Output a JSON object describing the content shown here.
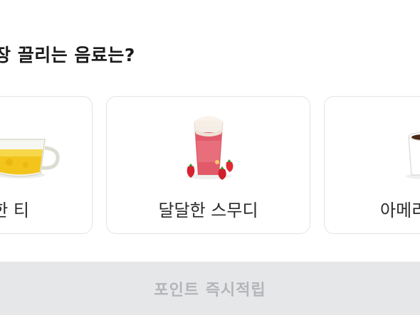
{
  "question": "장 끌리는 음료는?",
  "options": [
    {
      "label": "한 티",
      "icon": "tea-cup-icon"
    },
    {
      "label": "달달한 스무디",
      "icon": "strawberry-smoothie-icon"
    },
    {
      "label": "아메리",
      "icon": "coffee-cup-icon"
    }
  ],
  "cta": {
    "label": "포인트 즉시적립",
    "state": "disabled"
  },
  "colors": {
    "card_border": "#e3e3e3",
    "cta_background": "#e6e7e9",
    "cta_text": "#b3b5b8",
    "text": "#1a1a1a"
  }
}
